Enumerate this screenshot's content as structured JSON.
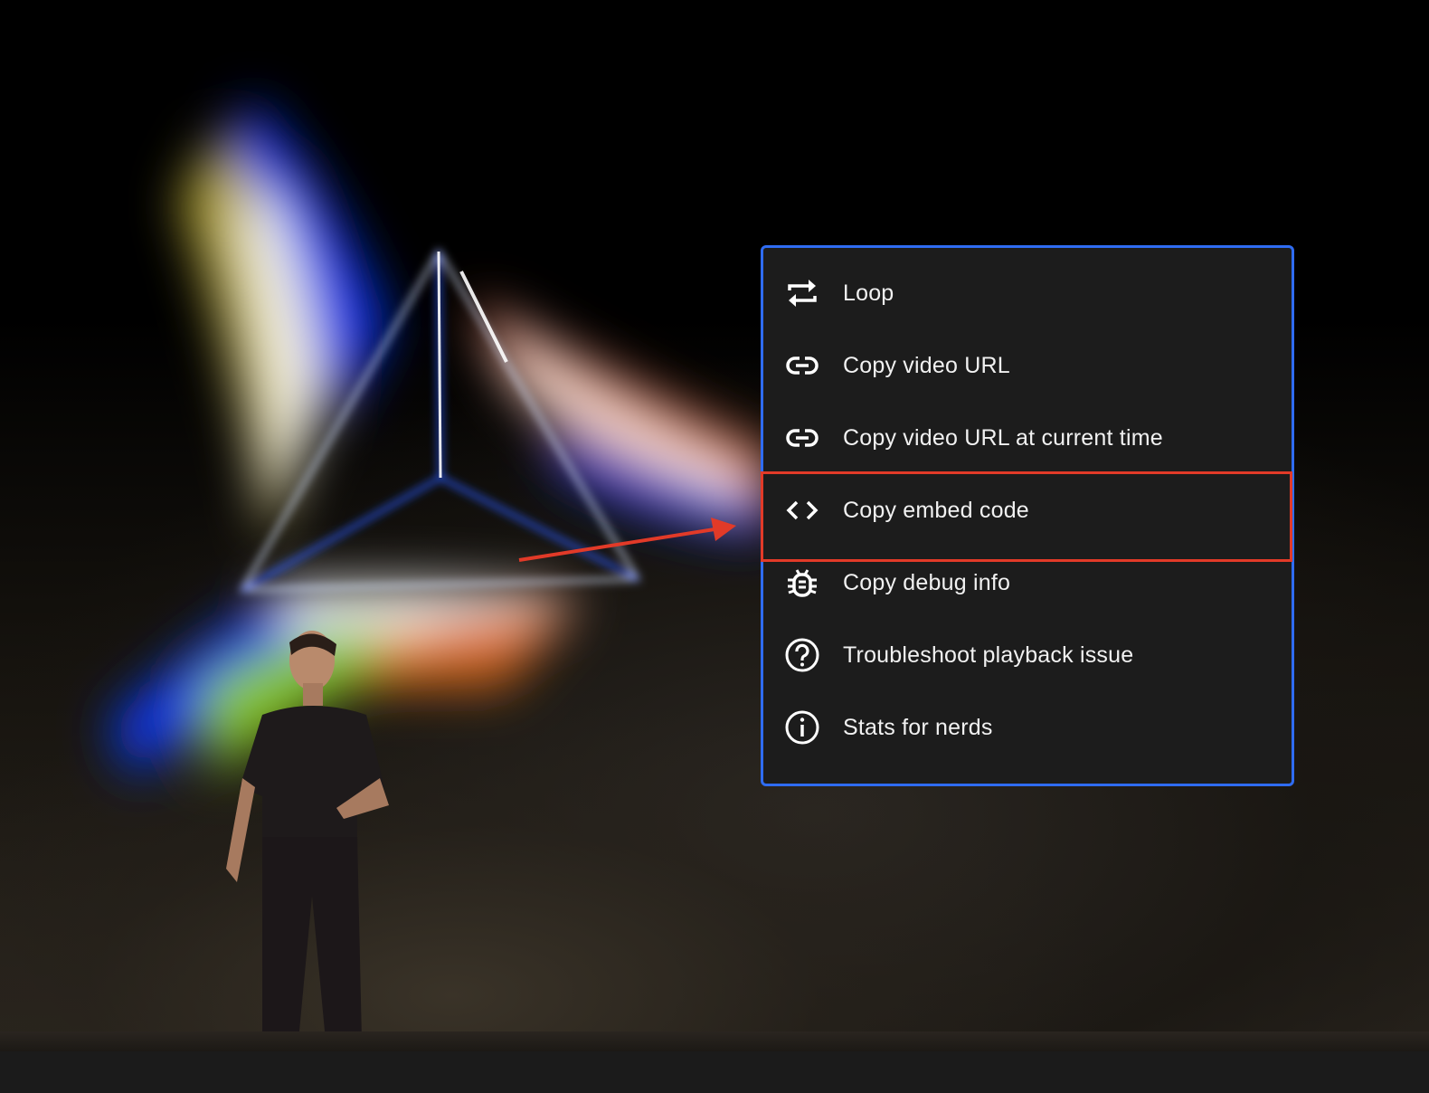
{
  "menu": {
    "items": [
      {
        "label": "Loop",
        "icon": "loop-icon"
      },
      {
        "label": "Copy video URL",
        "icon": "link-icon"
      },
      {
        "label": "Copy video URL at current time",
        "icon": "link-icon"
      },
      {
        "label": "Copy embed code",
        "icon": "embed-code-icon",
        "highlighted": true
      },
      {
        "label": "Copy debug info",
        "icon": "bug-icon"
      },
      {
        "label": "Troubleshoot playback issue",
        "icon": "question-circle-icon"
      },
      {
        "label": "Stats for nerds",
        "icon": "info-circle-icon"
      }
    ]
  },
  "colors": {
    "menu_background": "#1c1c1c",
    "menu_border": "#2f6cf2",
    "highlight_annotation": "#e23a28",
    "text": "#f1f1f1"
  }
}
